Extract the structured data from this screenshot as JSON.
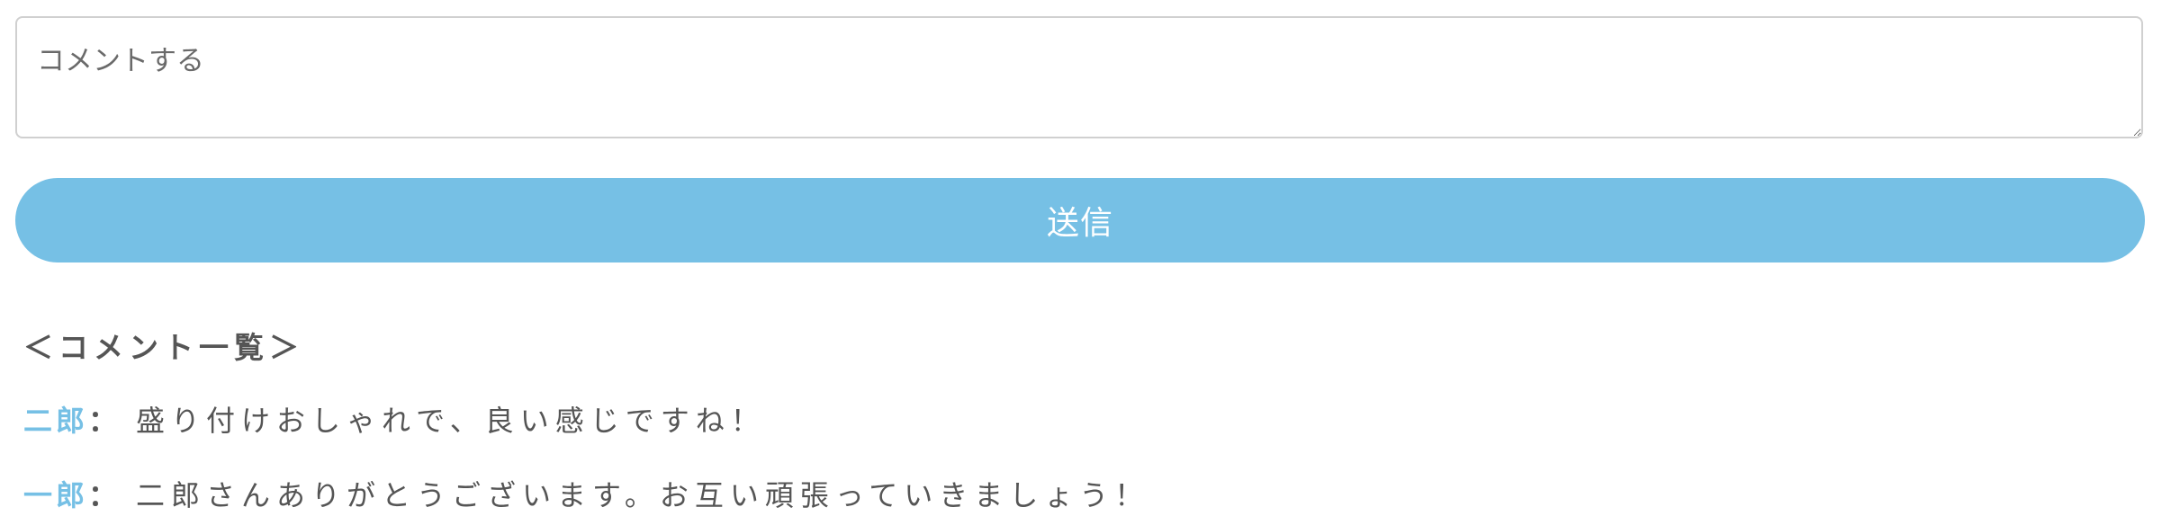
{
  "comment_form": {
    "placeholder": "コメントする",
    "value": "",
    "submit_label": "送信"
  },
  "comment_list": {
    "heading": "＜コメント一覧＞",
    "separator": "：",
    "items": [
      {
        "author": "二郎",
        "text": "盛り付けおしゃれで、良い感じですね！"
      },
      {
        "author": "一郎",
        "text": "二郎さんありがとうございます。お互い頑張っていきましょう！"
      }
    ]
  },
  "colors": {
    "accent": "#76c0e5",
    "text": "#555555",
    "border": "#d0d0d0"
  }
}
